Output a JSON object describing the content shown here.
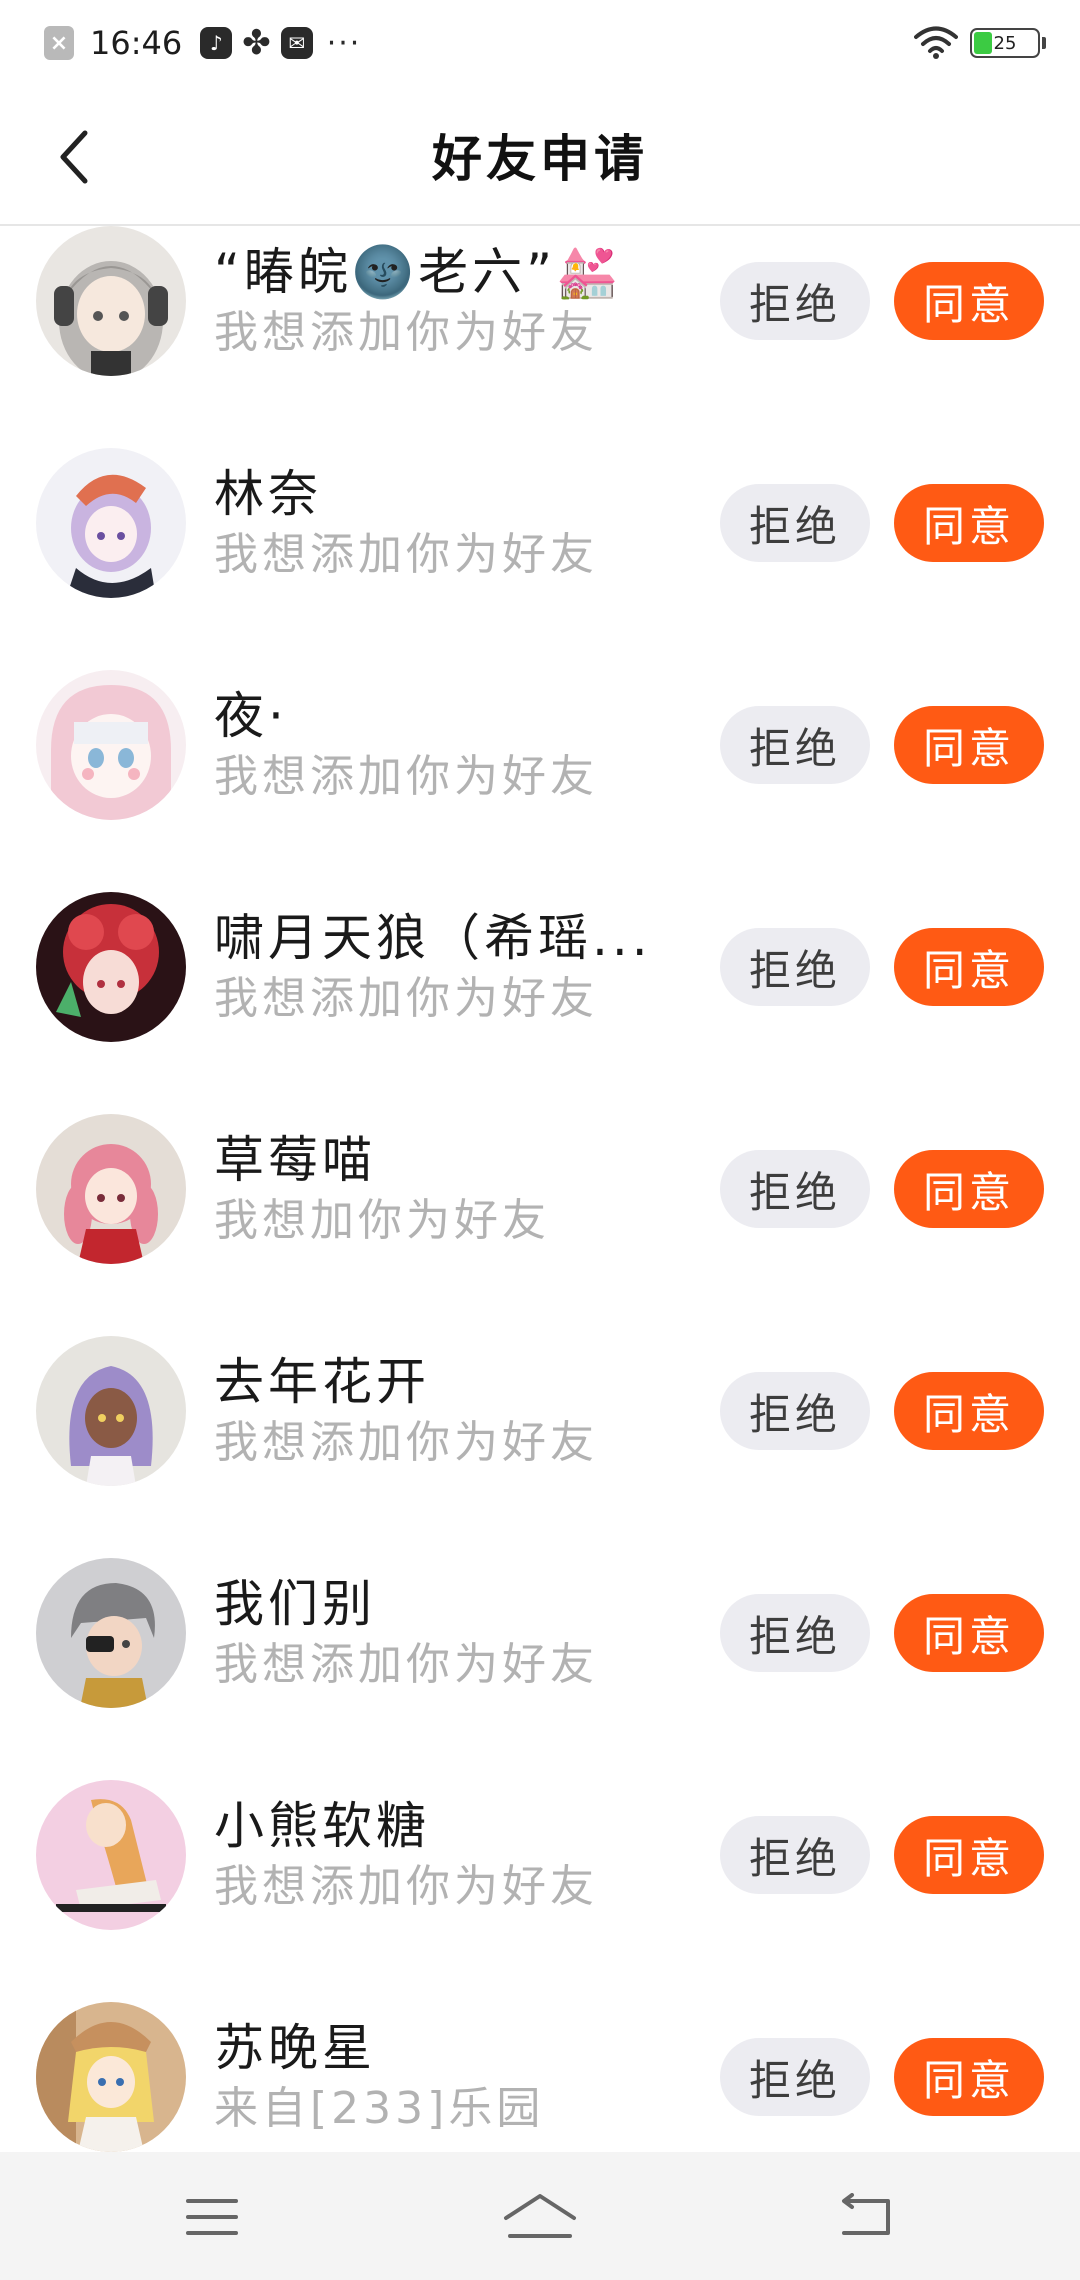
{
  "status_bar": {
    "time": "16:46",
    "battery_level": "25",
    "dots": "···",
    "icons": [
      "notification-x-icon",
      "music-icon",
      "fan-icon",
      "mail-icon",
      "wifi-icon",
      "battery-icon"
    ]
  },
  "header": {
    "title": "好友申请"
  },
  "colors": {
    "accept_button": "#ff5a14",
    "reject_button": "#ececf1",
    "secondary_text": "#b2b2b2"
  },
  "requests": [
    {
      "name": "“睶皖🌚老六”💒",
      "message": "我想添加你为好友",
      "reject_label": "拒绝",
      "accept_label": "同意"
    },
    {
      "name": "林奈",
      "message": "我想添加你为好友",
      "reject_label": "拒绝",
      "accept_label": "同意"
    },
    {
      "name": "夜·",
      "message": "我想添加你为好友",
      "reject_label": "拒绝",
      "accept_label": "同意"
    },
    {
      "name": "啸月天狼（希瑶...",
      "message": "我想添加你为好友",
      "reject_label": "拒绝",
      "accept_label": "同意"
    },
    {
      "name": "草莓喵",
      "message": "我想加你为好友",
      "reject_label": "拒绝",
      "accept_label": "同意"
    },
    {
      "name": "去年花开",
      "message": "我想添加你为好友",
      "reject_label": "拒绝",
      "accept_label": "同意"
    },
    {
      "name": "我们别",
      "message": "我想添加你为好友",
      "reject_label": "拒绝",
      "accept_label": "同意"
    },
    {
      "name": "小熊软糖",
      "message": "我想添加你为好友",
      "reject_label": "拒绝",
      "accept_label": "同意"
    },
    {
      "name": "苏晚星",
      "message": "来自[233]乐园",
      "reject_label": "拒绝",
      "accept_label": "同意"
    }
  ],
  "bottom_nav": {
    "icons": [
      "menu-icon",
      "home-icon",
      "back-nav-icon"
    ]
  }
}
